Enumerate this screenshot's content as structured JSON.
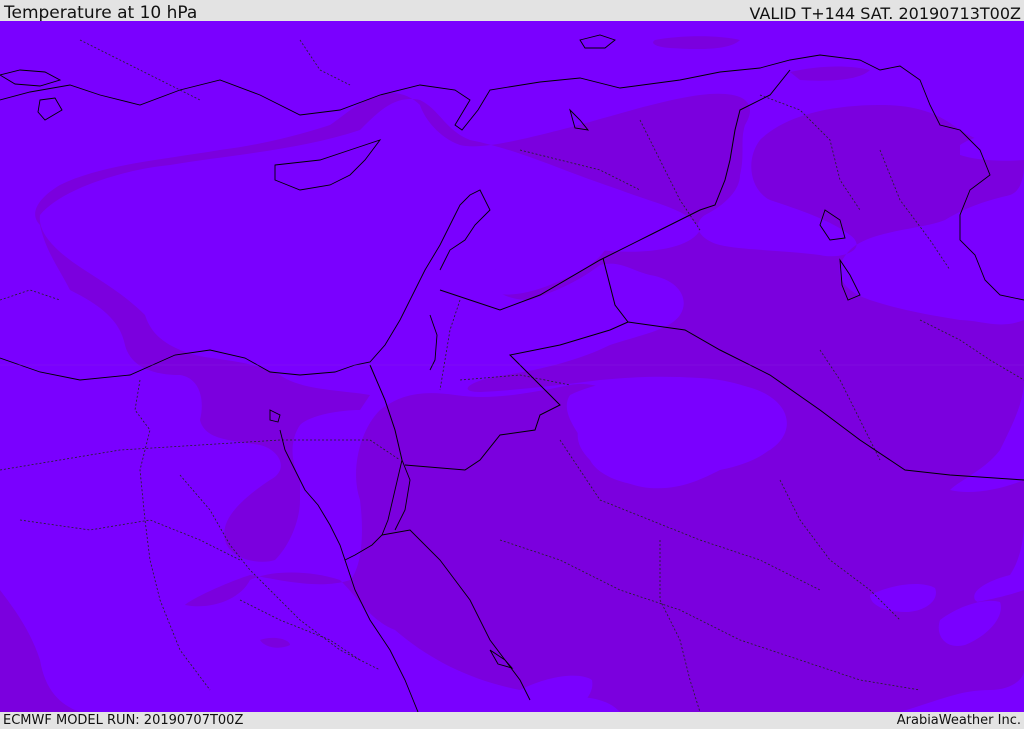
{
  "header": {
    "title": "Temperature at 10 hPa",
    "valid": "VALID T+144 SAT. 20190713T00Z"
  },
  "footer": {
    "model_run": "ECMWF MODEL RUN: 20190707T00Z",
    "credit": "ArabiaWeather Inc."
  },
  "map": {
    "colors": {
      "warm_band": "#7a00ff",
      "cool_band": "#7b00de",
      "coastline": "#000000",
      "border": "#222222"
    }
  }
}
